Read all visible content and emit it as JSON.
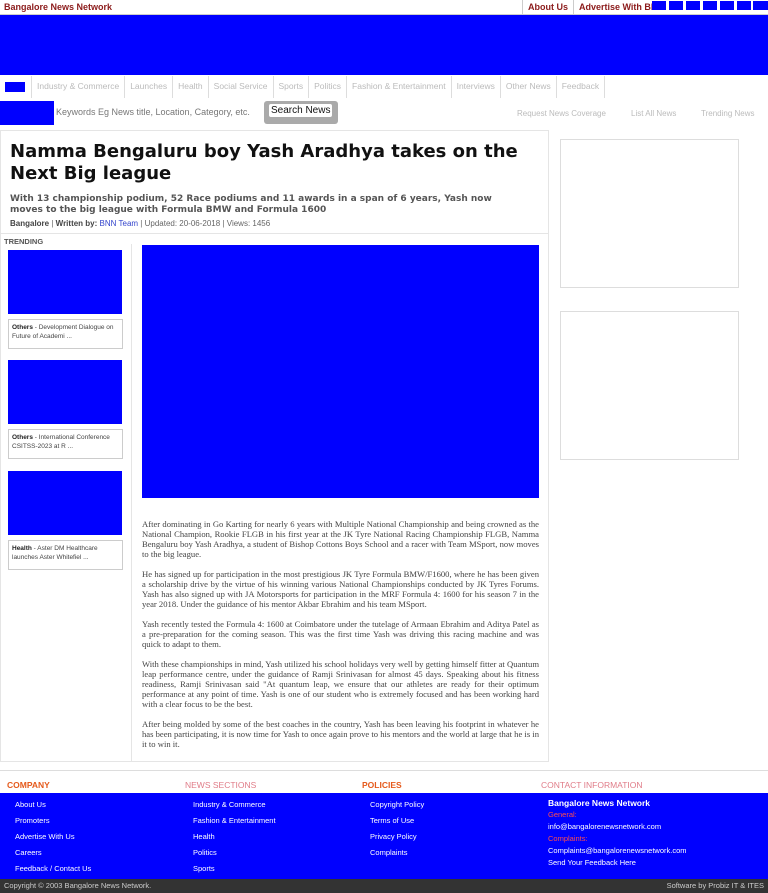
{
  "header": {
    "brand": "Bangalore News Network",
    "links": [
      "About Us",
      "Advertise With BNN"
    ]
  },
  "nav": {
    "items": [
      "Industry & Commerce",
      "Launches",
      "Health",
      "Social Service",
      "Sports",
      "Politics",
      "Fashion & Entertainment",
      "Interviews",
      "Other News",
      "Feedback"
    ]
  },
  "search": {
    "placeholder": "Keywords Eg News title, Location, Category, etc.",
    "button": "Search News",
    "links": [
      "Request News Coverage",
      "List All News",
      "Trending News"
    ]
  },
  "article": {
    "title": "Namma Bengaluru boy Yash Aradhya takes on the Next Big league",
    "subtitle": "With 13 championship podium, 52 Race podiums and 11 awards in a span of 6 years, Yash now moves to the big league with Formula BMW and Formula 1600",
    "location": "Bangalore",
    "written_by_label": "Written by:",
    "author": "BNN Team",
    "updated": "Updated: 20-06-2018",
    "views": "Views: 1456",
    "paragraphs": [
      "After dominating in Go Karting for nearly 6 years with Multiple National Championship and being crowned as the National Champion, Rookie FLGB in his first year at the JK Tyre National Racing Championship FLGB, Namma Bengaluru boy Yash Aradhya, a student of Bishop Cottons Boys School and a racer with Team MSport, now moves to the big league.",
      "He has signed up for participation in the most prestigious JK Tyre Formula BMW/F1600, where he has been given a scholarship drive by the virtue of his winning various National Championships conducted by JK Tyres Forums. Yash has also signed up with JA Motorsports for participation in the MRF Formula 4: 1600 for his season 7 in the year 2018. Under the guidance of his mentor Akbar Ebrahim and his team MSport.",
      "Yash recently tested the Formula 4: 1600 at Coimbatore under the tutelage of Armaan Ebrahim and Aditya Patel as a pre-preparation for the coming season. This was the first time Yash was driving this racing machine and was quick to adapt to them.",
      "With these championships in mind, Yash utilized his school holidays very well by getting himself fitter at Quantum leap performance centre, under the guidance of Ramji Srinivasan for almost 45 days. Speaking about his fitness readiness, Ramji Srinivasan said \"At quantum leap, we ensure that our athletes are ready for their optimum performance at any point of time. Yash is one of our student who is extremely focused and has been working hard with a clear focus to be the best.",
      "After being molded by some of the best coaches in the country, Yash has been leaving his footprint in whatever he has been participating, it is now time for Yash to once again prove to his mentors and the world at large that he is in it to win it."
    ]
  },
  "trending": {
    "label": "TRENDING",
    "items": [
      {
        "category": "Others",
        "text": "Development Dialogue on Future of Academi ..."
      },
      {
        "category": "Others",
        "text": "International Conference CSITSS-2023 at R ..."
      },
      {
        "category": "Health",
        "text": "Aster DM Healthcare launches Aster Whitefiel ..."
      }
    ]
  },
  "footer": {
    "headings": [
      "COMPANY",
      "NEWS SECTIONS",
      "POLICIES",
      "CONTACT INFORMATION"
    ],
    "company": [
      "About Us",
      "Promoters",
      "Advertise With Us",
      "Careers",
      "Feedback / Contact Us"
    ],
    "sections": [
      "Industry & Commerce",
      "Fashion & Entertainment",
      "Health",
      "Politics",
      "Sports"
    ],
    "policies": [
      "Copyright Policy",
      "Terms of Use",
      "Privacy Policy",
      "Complaints"
    ],
    "contact": {
      "name": "Bangalore News Network",
      "general_label": "General:",
      "general_email": "info@bangalorenewsnetwork.com",
      "complaints_label": "Complaints:",
      "complaints_email": "Complaints@bangalorenewsnetwork.com",
      "feedback": "Send Your Feedback Here"
    },
    "copyright": "Copyright © 2003 Bangalore News Network.",
    "software": "Software by Probiz IT & ITES"
  },
  "colors": {
    "accent": "#0000ff",
    "brand": "#8b1a1a",
    "footer_heading": "#e55a1c"
  }
}
